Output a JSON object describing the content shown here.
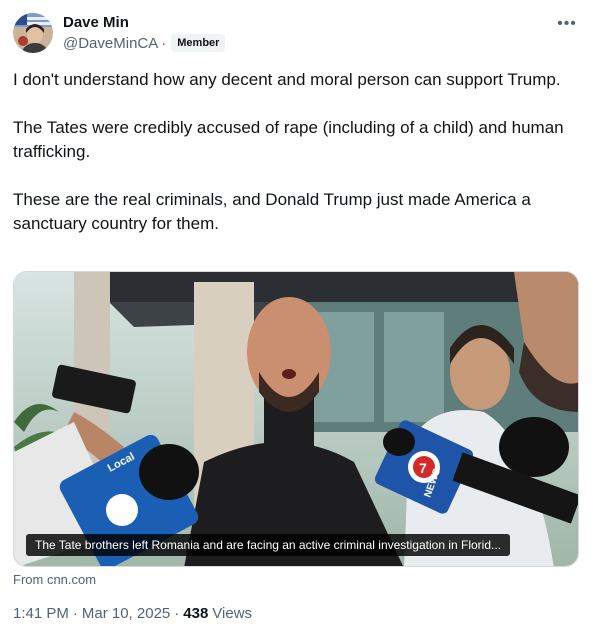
{
  "author": {
    "name": "Dave Min",
    "handle": "@DaveMinCA",
    "badge": "Member"
  },
  "tweet": {
    "text": "I don't understand how any decent and moral person can support Trump.\n\nThe Tates were credibly accused of rape (including of a child) and human trafficking.\n\nThese are the real criminals, and Donald Trump just made America a sanctuary country for them."
  },
  "media": {
    "caption": "The Tate brothers left Romania and are facing an active criminal investigation in Florid...",
    "mic_flags": [
      "Local 10 News",
      "7 News"
    ]
  },
  "card": {
    "source": "From cnn.com"
  },
  "meta": {
    "time": "1:41 PM",
    "date": "Mar 10, 2025",
    "views_count": "438",
    "views_label": "Views"
  },
  "icons": {
    "more": "more-options-icon"
  },
  "colors": {
    "text_primary": "#0f1419",
    "text_secondary": "#536471",
    "border": "#cfd9de",
    "badge_bg": "#eff3f4"
  }
}
